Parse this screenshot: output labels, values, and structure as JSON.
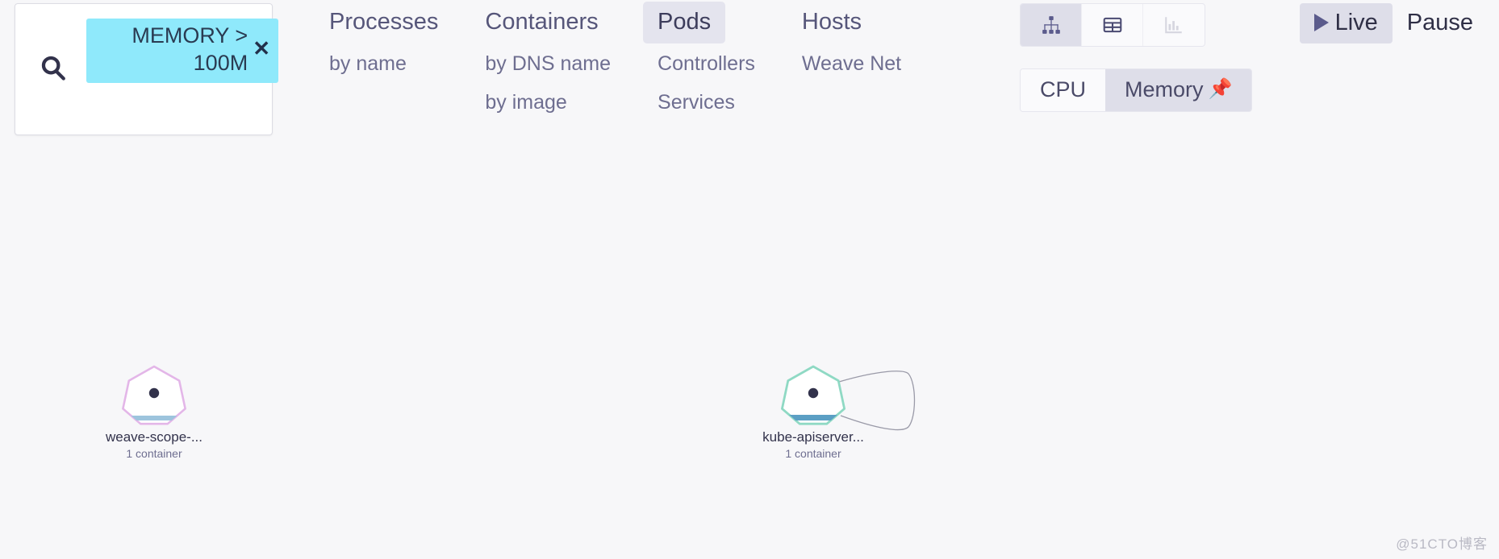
{
  "search": {
    "icon": "search-icon",
    "placeholder": "",
    "value": "",
    "chip": {
      "label": "MEMORY > 100M",
      "close_label": "✕",
      "background": "#8fe9fb",
      "text_color": "#2a3b52"
    }
  },
  "topology_nav": {
    "columns": [
      {
        "main": {
          "label": "Processes",
          "active": false
        },
        "subs": [
          {
            "label": "by name",
            "active": false
          }
        ]
      },
      {
        "main": {
          "label": "Containers",
          "active": false
        },
        "subs": [
          {
            "label": "by DNS name",
            "active": false
          },
          {
            "label": "by image",
            "active": false
          }
        ]
      },
      {
        "main": {
          "label": "Pods",
          "active": true
        },
        "subs": [
          {
            "label": "Controllers",
            "active": false
          },
          {
            "label": "Services",
            "active": false
          }
        ]
      },
      {
        "main": {
          "label": "Hosts",
          "active": false
        },
        "subs": [
          {
            "label": "Weave Net",
            "active": false
          }
        ]
      }
    ]
  },
  "view_modes": [
    {
      "name": "graph-view-icon",
      "label": "Graph",
      "active": true,
      "disabled": false
    },
    {
      "name": "table-view-icon",
      "label": "Table",
      "active": false,
      "disabled": false
    },
    {
      "name": "resource-view-icon",
      "label": "Resources",
      "active": false,
      "disabled": true
    }
  ],
  "metric_toggle": [
    {
      "label": "CPU",
      "active": false,
      "pinned": false
    },
    {
      "label": "Memory",
      "active": true,
      "pinned": true,
      "pin_icon": "📌"
    }
  ],
  "time_controls": [
    {
      "label": "Live",
      "active": true,
      "icon": "play-icon"
    },
    {
      "label": "Pause",
      "active": false,
      "icon": null
    }
  ],
  "graph": {
    "nodes": [
      {
        "id": "weave-scope",
        "label": "weave-scope-...",
        "sublabel": "1 container",
        "border_color": "#e3b6e8",
        "metric_color": "#9dc4dd",
        "metric_fill": 0.28,
        "has_self_loop": false
      },
      {
        "id": "kube-apiserver",
        "label": "kube-apiserver...",
        "sublabel": "1 container",
        "border_color": "#8fd9c4",
        "metric_color": "#5b9fc4",
        "metric_fill": 0.34,
        "has_self_loop": true
      }
    ],
    "edge_color": "#9a9aa8"
  },
  "watermark": {
    "text": "@51CTO博客"
  },
  "colors": {
    "page_background": "#f7f7f9",
    "active_tab_background": "#e4e4ee",
    "text_primary": "#32324b",
    "text_secondary": "#6e6e90",
    "chip_cyan": "#8fe9fb",
    "pin_orange": "#f04e23"
  }
}
